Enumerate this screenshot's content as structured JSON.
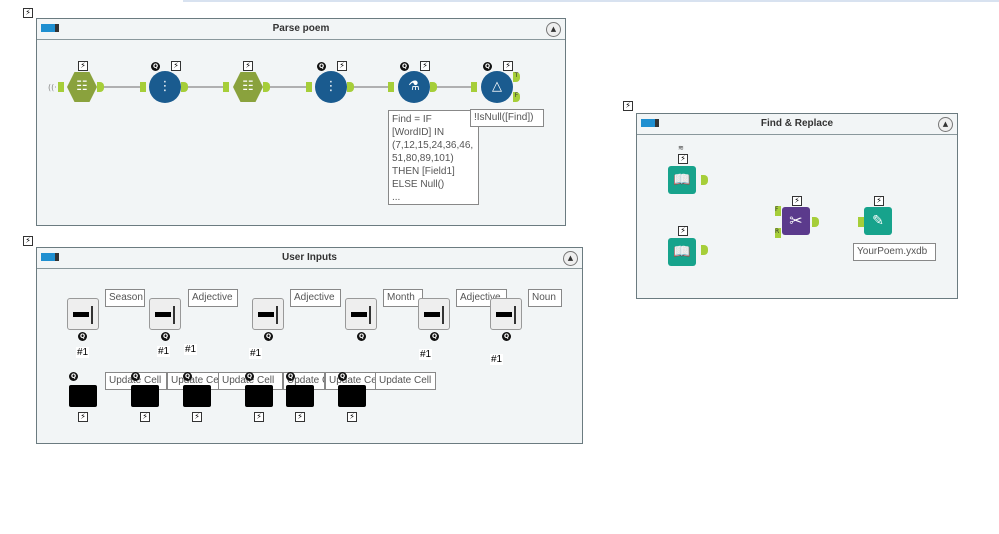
{
  "containers": {
    "parse": {
      "title": "Parse poem",
      "annotation_formula": [
        "Find = IF",
        "[WordID] IN",
        "(7,12,15,24,36,46,",
        "51,80,89,101)",
        "THEN [Field1]",
        "ELSE Null()",
        "..."
      ],
      "annotation_filter": "!IsNull([Find])",
      "filter_true": "T",
      "filter_false": "F"
    },
    "inputs": {
      "title": "User Inputs",
      "labels": [
        "Season",
        "Adjective",
        "Adjective",
        "Month",
        "Adjective",
        "Noun"
      ],
      "connection_label": "#1",
      "action_labels": [
        "Update Cell",
        "Update Cell",
        "Update Cell",
        "Update Cell",
        "Update Cell",
        "Update Cell"
      ]
    },
    "replace": {
      "title": "Find & Replace",
      "output_label": "YourPoem.yxdb",
      "anchor_f": "F",
      "anchor_r": "R"
    }
  },
  "icons": {
    "bolt": "⚡",
    "q": "Q",
    "collapse": "▲"
  },
  "colors": {
    "accent": "#1f8fd0",
    "anchor": "#a6ce39",
    "teal": "#17a38c",
    "purple": "#5b3a8c",
    "navy": "#1a5b8f",
    "olive": "#8aa23d"
  }
}
